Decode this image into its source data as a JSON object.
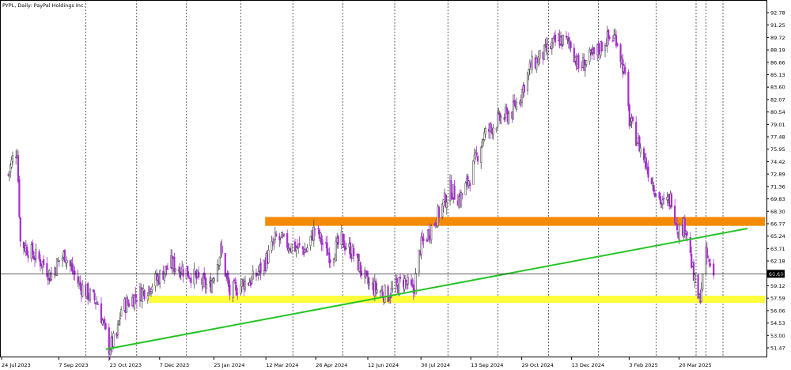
{
  "header": {
    "symbol": "PYPL",
    "timeframe": "Daily",
    "name": "PayPal Holdings Inc.",
    "text": "PYPL, Daily:  PayPal Holdings Inc."
  },
  "current_price_label": "60.60",
  "colors": {
    "bull_candle": "#4d4d4d",
    "bear_candle": "#a62fd0",
    "orange_zone": "#f58a07",
    "yellow_zone": "#ffff3c",
    "trendline": "#25c425",
    "grid": "#000000",
    "price_line": "#000000",
    "background": "#ffffff"
  },
  "chart_data": {
    "type": "candlestick",
    "title": "PYPL, Daily:  PayPal Holdings Inc.",
    "y_ticks": [
      "92.78",
      "91.25",
      "89.72",
      "88.19",
      "86.66",
      "85.13",
      "83.60",
      "82.07",
      "80.54",
      "79.01",
      "77.48",
      "75.95",
      "74.42",
      "72.89",
      "71.36",
      "69.83",
      "68.30",
      "66.77",
      "65.24",
      "63.71",
      "62.18",
      "60.65",
      "59.12",
      "57.59",
      "56.06",
      "54.53",
      "53.00",
      "51.47"
    ],
    "x_ticks": [
      "24 Jul 2023",
      "7 Sep 2023",
      "23 Oct 2023",
      "7 Dec 2023",
      "25 Jan 2024",
      "12 Mar 2024",
      "26 Apr 2024",
      "12 Jun 2024",
      "30 Jul 2024",
      "13 Sep 2024",
      "29 Oct 2024",
      "13 Dec 2024",
      "3 Feb 2025",
      "20 Mar 2025"
    ],
    "ylim": [
      50.3,
      93.9
    ],
    "last_price": 60.6,
    "price_path": [
      [
        "2023-07-24",
        72.8
      ],
      [
        "2023-07-28",
        74.8
      ],
      [
        "2023-08-01",
        76.0
      ],
      [
        "2023-08-04",
        64.5
      ],
      [
        "2023-08-14",
        63.2
      ],
      [
        "2023-08-25",
        61.8
      ],
      [
        "2023-08-31",
        60.4
      ],
      [
        "2023-09-07",
        62.0
      ],
      [
        "2023-09-13",
        63.0
      ],
      [
        "2023-09-18",
        61.5
      ],
      [
        "2023-09-26",
        59.3
      ],
      [
        "2023-10-05",
        58.0
      ],
      [
        "2023-10-13",
        57.0
      ],
      [
        "2023-10-23",
        51.5
      ],
      [
        "2023-10-30",
        52.8
      ],
      [
        "2023-11-03",
        56.3
      ],
      [
        "2023-11-13",
        57.5
      ],
      [
        "2023-11-28",
        59.0
      ],
      [
        "2023-12-07",
        60.2
      ],
      [
        "2023-12-18",
        61.8
      ],
      [
        "2024-01-01",
        60.9
      ],
      [
        "2024-01-12",
        59.8
      ],
      [
        "2024-01-22",
        58.9
      ],
      [
        "2024-02-01",
        63.5
      ],
      [
        "2024-02-09",
        58.2
      ],
      [
        "2024-02-20",
        59.4
      ],
      [
        "2024-03-01",
        59.9
      ],
      [
        "2024-03-12",
        62.0
      ],
      [
        "2024-03-22",
        65.0
      ],
      [
        "2024-04-05",
        64.0
      ],
      [
        "2024-04-18",
        63.5
      ],
      [
        "2024-04-26",
        66.2
      ],
      [
        "2024-05-02",
        64.5
      ],
      [
        "2024-05-10",
        62.8
      ],
      [
        "2024-05-20",
        64.7
      ],
      [
        "2024-05-31",
        63.0
      ],
      [
        "2024-06-12",
        59.4
      ],
      [
        "2024-06-20",
        58.7
      ],
      [
        "2024-07-01",
        58.0
      ],
      [
        "2024-07-15",
        59.8
      ],
      [
        "2024-07-24",
        58.3
      ],
      [
        "2024-07-30",
        63.8
      ],
      [
        "2024-08-15",
        67.8
      ],
      [
        "2024-08-26",
        71.0
      ],
      [
        "2024-09-04",
        69.8
      ],
      [
        "2024-09-13",
        72.5
      ],
      [
        "2024-09-25",
        77.5
      ],
      [
        "2024-10-08",
        79.5
      ],
      [
        "2024-10-21",
        80.5
      ],
      [
        "2024-10-29",
        82.8
      ],
      [
        "2024-11-07",
        86.2
      ],
      [
        "2024-11-21",
        88.0
      ],
      [
        "2024-12-02",
        89.5
      ],
      [
        "2024-12-13",
        89.0
      ],
      [
        "2024-12-20",
        86.0
      ],
      [
        "2025-01-03",
        87.5
      ],
      [
        "2025-01-14",
        89.5
      ],
      [
        "2025-01-23",
        89.8
      ],
      [
        "2025-01-30",
        85.6
      ],
      [
        "2025-02-04",
        79.5
      ],
      [
        "2025-02-14",
        76.0
      ],
      [
        "2025-02-26",
        71.5
      ],
      [
        "2025-03-06",
        69.0
      ],
      [
        "2025-03-14",
        69.9
      ],
      [
        "2025-03-20",
        66.0
      ],
      [
        "2025-03-27",
        66.6
      ],
      [
        "2025-04-03",
        60.0
      ],
      [
        "2025-04-08",
        57.2
      ],
      [
        "2025-04-14",
        62.8
      ],
      [
        "2025-04-21",
        60.6
      ]
    ],
    "annotations": [
      {
        "kind": "horizontal_zone",
        "color": "orange",
        "price_low": 66.8,
        "price_high": 67.6,
        "from": "2024-03-12",
        "to": "end"
      },
      {
        "kind": "horizontal_zone",
        "color": "yellow",
        "price_low": 57.3,
        "price_high": 57.9,
        "from": "2023-11-28",
        "to": "end"
      },
      {
        "kind": "trendline",
        "color": "green",
        "from": [
          "2023-10-23",
          51.3
        ],
        "to": [
          "2025-06-01",
          66.3
        ]
      },
      {
        "kind": "price_line",
        "price": 60.6
      }
    ]
  }
}
